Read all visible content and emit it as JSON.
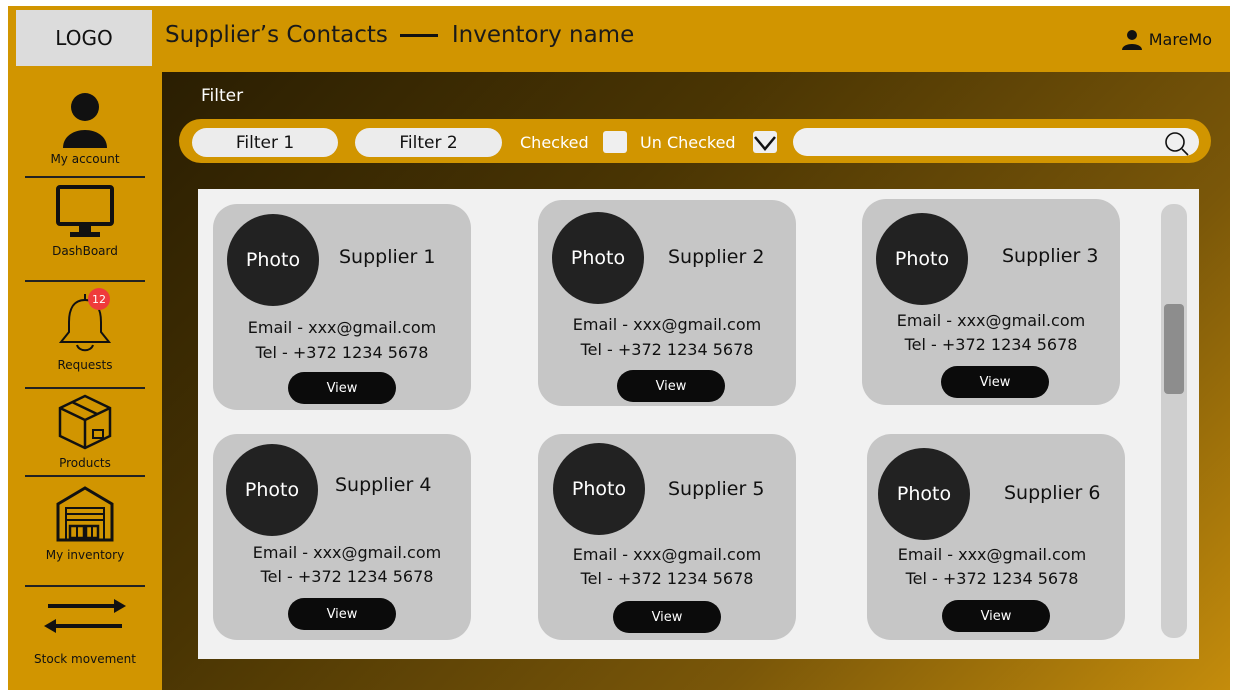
{
  "header": {
    "logo": "LOGO",
    "title_left": "Supplier’s Contacts",
    "title_right": "Inventory name",
    "user": "MareMo"
  },
  "sidebar": {
    "items": [
      {
        "label": "My account",
        "icon": "person-icon"
      },
      {
        "label": "DashBoard",
        "icon": "monitor-icon"
      },
      {
        "label": "Requests",
        "icon": "bell-icon",
        "badge": "12"
      },
      {
        "label": "Products",
        "icon": "box-icon"
      },
      {
        "label": "My inventory",
        "icon": "warehouse-icon"
      },
      {
        "label": "Stock movement",
        "icon": "arrows-icon"
      }
    ]
  },
  "filter": {
    "title": "Filter",
    "filter1": "Filter 1",
    "filter2": "Filter 2",
    "checked_label": "Checked",
    "unchecked_label": "Un Checked",
    "checked_state": false,
    "unchecked_state": true
  },
  "suppliers": [
    {
      "photo": "Photo",
      "name": "Supplier 1",
      "email": "Email - xxx@gmail.com",
      "tel": "Tel - +372 1234 5678",
      "view": "View"
    },
    {
      "photo": "Photo",
      "name": "Supplier 2",
      "email": "Email - xxx@gmail.com",
      "tel": "Tel - +372 1234 5678",
      "view": "View"
    },
    {
      "photo": "Photo",
      "name": "Supplier 3",
      "email": "Email - xxx@gmail.com",
      "tel": "Tel - +372 1234 5678",
      "view": "View"
    },
    {
      "photo": "Photo",
      "name": "Supplier 4",
      "email": "Email - xxx@gmail.com",
      "tel": "Tel - +372 1234 5678",
      "view": "View"
    },
    {
      "photo": "Photo",
      "name": "Supplier 5",
      "email": "Email - xxx@gmail.com",
      "tel": "Tel - +372 1234 5678",
      "view": "View"
    },
    {
      "photo": "Photo",
      "name": "Supplier 6",
      "email": "Email - xxx@gmail.com",
      "tel": "Tel - +372 1234 5678",
      "view": "View"
    }
  ],
  "colors": {
    "brand": "#d19500",
    "card": "#c6c6c6",
    "photo": "#222222",
    "button": "#0b0b0b",
    "badge": "#ef3b3b"
  }
}
